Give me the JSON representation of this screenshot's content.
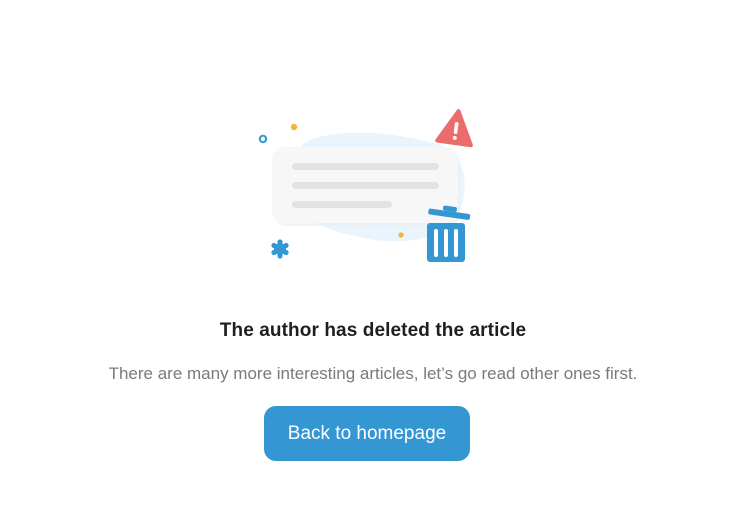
{
  "empty_state": {
    "title": "The author has deleted the article",
    "subtitle": "There are many more interesting articles, let’s go read other ones first.",
    "button_label": "Back to homepage",
    "illustration_icons": [
      "deleted-article-illustration",
      "warning-icon",
      "trash-icon"
    ]
  },
  "colors": {
    "accent": "#3497d3",
    "warning": "#ec6b6b",
    "dot_orange": "#f5b23c",
    "title": "#1f1f1f",
    "subtitle": "#7a7a7a"
  }
}
